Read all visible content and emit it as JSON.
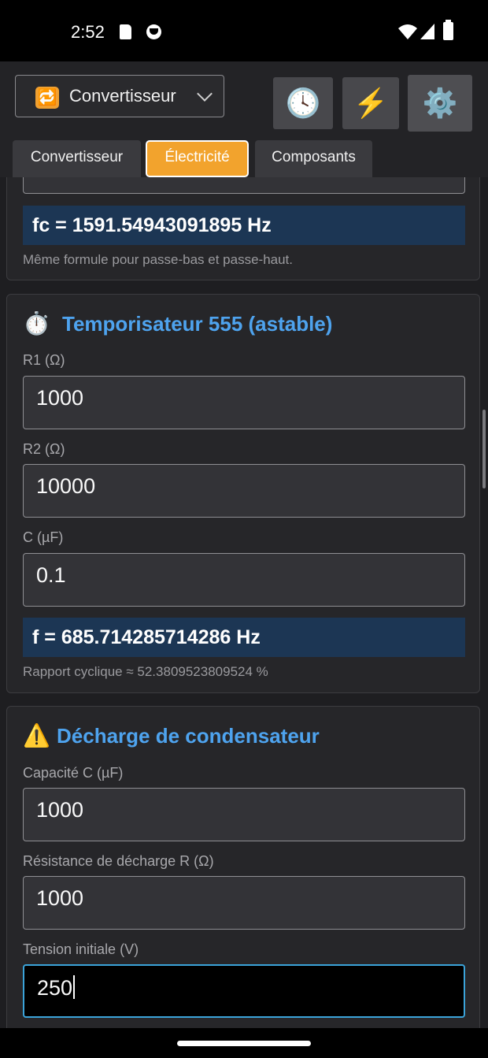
{
  "status": {
    "time": "2:52"
  },
  "appbar": {
    "mode_select": {
      "icon": "🔁",
      "label": "Convertisseur"
    },
    "icons": {
      "history": "🕓",
      "power": "⚡",
      "settings": "⚙️"
    }
  },
  "tabs": [
    {
      "label": "Convertisseur"
    },
    {
      "label": "Électricité"
    },
    {
      "label": "Composants"
    }
  ],
  "filter_card": {
    "result": "fc = 1591.54943091895 Hz",
    "note": "Même formule pour passe-bas et passe-haut."
  },
  "timer_card": {
    "icon": "⏱️",
    "title": "Temporisateur 555 (astable)",
    "r1_label": "R1 (Ω)",
    "r1_value": "1000",
    "r2_label": "R2 (Ω)",
    "r2_value": "10000",
    "c_label": "C (µF)",
    "c_value": "0.1",
    "result": "f = 685.714285714286 Hz",
    "note": "Rapport cyclique ≈ 52.3809523809524 %"
  },
  "discharge_card": {
    "icon": "⚠️",
    "title": "Décharge de condensateur",
    "cap_label": "Capacité C (µF)",
    "cap_value": "1000",
    "res_label": "Résistance de décharge R (Ω)",
    "res_value": "1000",
    "volt_label": "Tension initiale (V)",
    "volt_value": "250"
  }
}
